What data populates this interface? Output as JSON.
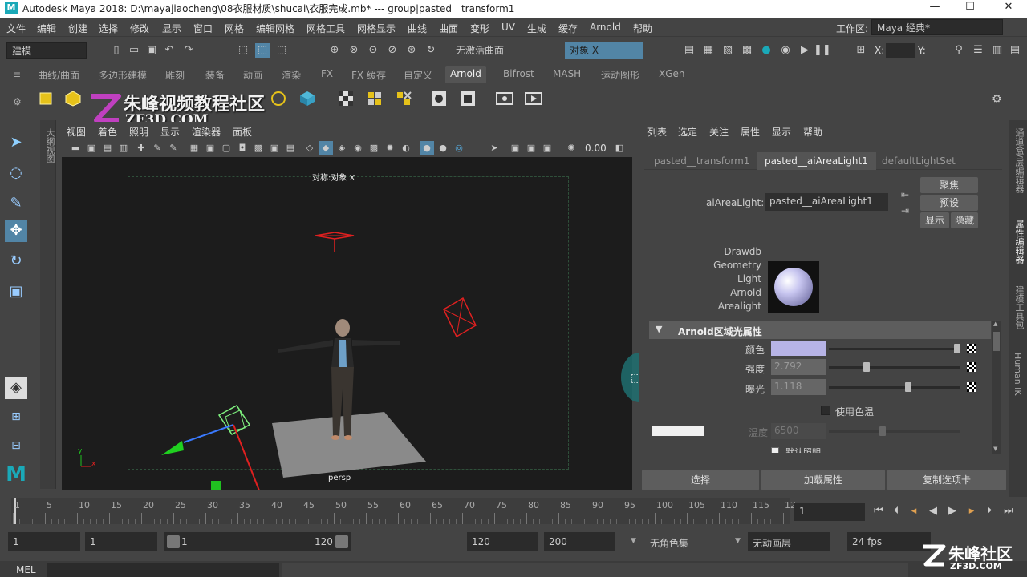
{
  "window": {
    "title": "Autodesk Maya 2018: D:\\mayajiaocheng\\08衣服材质\\shucai\\衣服完成.mb*   ---   group|pasted__transform1",
    "logo_letter": "M",
    "minimize": "—",
    "maximize": "☐",
    "close": "✕"
  },
  "menubar": {
    "items": [
      "文件",
      "编辑",
      "创建",
      "选择",
      "修改",
      "显示",
      "窗口",
      "网格",
      "编辑网格",
      "网格工具",
      "网格显示",
      "曲线",
      "曲面",
      "变形",
      "UV",
      "生成",
      "Arnold",
      "缓存",
      "帮助"
    ],
    "workspace_label": "工作区:",
    "workspace_value": "Maya 经典*"
  },
  "statusline": {
    "mode": "建模",
    "live_surface": "无激活曲面",
    "symmetry": "对象 X",
    "x_label": "X:",
    "y_label": "Y:"
  },
  "shelf": {
    "tabs": [
      "曲线/曲面",
      "多边形建模",
      "雕刻",
      "装备",
      "动画",
      "渲染",
      "FX",
      "FX 缓存",
      "自定义",
      "Arnold",
      "Bifrost",
      "MASH",
      "运动图形",
      "XGen"
    ],
    "active_tab": "Arnold"
  },
  "watermark": {
    "title": "朱峰视频教程社区",
    "url": "ZF3D.COM",
    "corner_title": "朱峰社区",
    "corner_url": "ZF3D.COM"
  },
  "outliner_strip": {
    "label": "大纲视图"
  },
  "viewport": {
    "menus": [
      "视图",
      "着色",
      "照明",
      "显示",
      "渲染器",
      "面板"
    ],
    "exposure": "0.00",
    "hud_top": "对称:对象 X",
    "camera": "persp",
    "axis_x": "x",
    "axis_y": "y"
  },
  "attribute_editor": {
    "menus": [
      "列表",
      "选定",
      "关注",
      "属性",
      "显示",
      "帮助"
    ],
    "tabs": [
      "pasted__transform1",
      "pasted__aiAreaLight1",
      "defaultLightSet"
    ],
    "active_tab": "pasted__aiAreaLight1",
    "node_label": "aiAreaLight:",
    "node_value": "pasted__aiAreaLight1",
    "btn_focus": "聚焦",
    "btn_presets": "预设",
    "btn_show": "显示",
    "btn_hide": "隐藏",
    "swatch_text": [
      "Drawdb",
      "Geometry",
      "Light",
      "Arnold",
      "Arealight"
    ],
    "section_title": "Arnold区域光属性",
    "color_label": "颜色",
    "color_value": "#b7b4e6",
    "intensity_label": "强度",
    "intensity_value": "2.792",
    "exposure_label": "曝光",
    "exposure_value": "1.118",
    "use_temp_label": "使用色温",
    "temp_label": "温度",
    "temp_value": "6500",
    "illum_label": "默认照明",
    "footer_select": "选择",
    "footer_load": "加载属性",
    "footer_copy": "复制选项卡"
  },
  "side_tabs": [
    "通道盒/层编辑器",
    "属性编辑器",
    "建模工具包",
    "Human IK"
  ],
  "timeline": {
    "ticks": [
      "1",
      "5",
      "10",
      "15",
      "20",
      "25",
      "30",
      "35",
      "40",
      "45",
      "50",
      "55",
      "60",
      "65",
      "70",
      "75",
      "80",
      "85",
      "90",
      "95",
      "100",
      "105",
      "110",
      "115",
      "12"
    ],
    "current_frame": "1"
  },
  "range": {
    "start": "1",
    "playback_start": "1",
    "slider_start": "1",
    "slider_end": "120",
    "playback_end": "120",
    "end": "200",
    "char_set": "无角色集",
    "anim_layer": "无动画层",
    "fps": "24 fps"
  },
  "cmdline": {
    "label": "MEL"
  }
}
